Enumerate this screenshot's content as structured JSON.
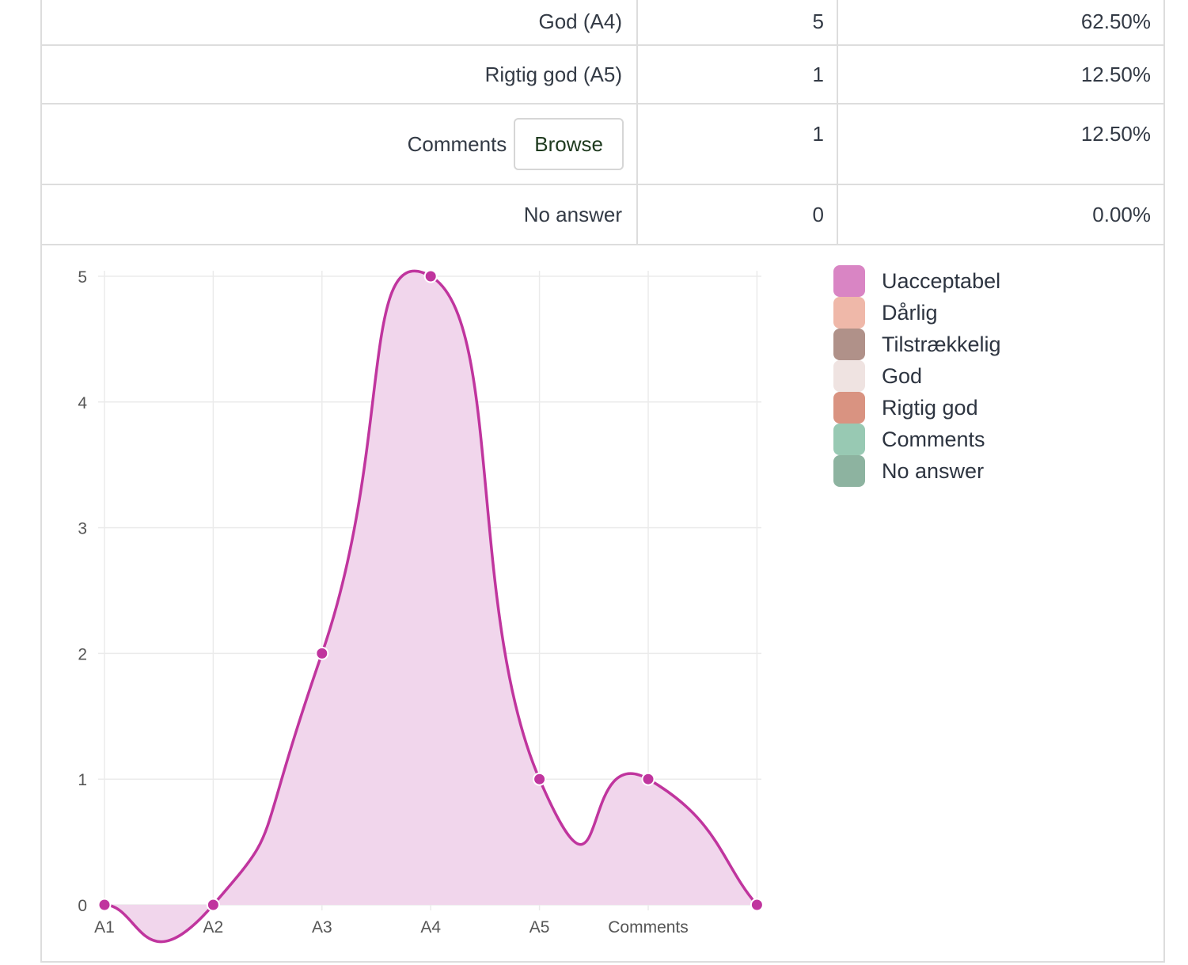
{
  "table": {
    "rows": [
      {
        "label": "God (A4)",
        "count": "5",
        "percent": "62.50%"
      },
      {
        "label": "Rigtig god (A5)",
        "count": "1",
        "percent": "12.50%"
      },
      {
        "label": "Comments",
        "button": "Browse",
        "count": "1",
        "percent": "12.50%"
      },
      {
        "label": "No answer",
        "count": "0",
        "percent": "0.00%"
      }
    ]
  },
  "chart_data": {
    "type": "area",
    "categories": [
      "A1",
      "A2",
      "A3",
      "A4",
      "A5",
      "Comments",
      ""
    ],
    "values": [
      0,
      0,
      2,
      5,
      1,
      1,
      0
    ],
    "ylim": [
      0,
      5
    ],
    "yticks": [
      "0",
      "1",
      "2",
      "3",
      "4",
      "5"
    ],
    "grid": true,
    "line_color": "#c0359e",
    "fill_color": "#f1d6ec",
    "legend_position": "right",
    "legend": [
      {
        "label": "Uacceptabel",
        "color": "#d985c4"
      },
      {
        "label": "Dårlig",
        "color": "#efb8a9"
      },
      {
        "label": "Tilstrækkelig",
        "color": "#b09189"
      },
      {
        "label": "God",
        "color": "#efe3e1"
      },
      {
        "label": "Rigtig god",
        "color": "#d99381"
      },
      {
        "label": "Comments",
        "color": "#98c9b3"
      },
      {
        "label": "No answer",
        "color": "#8db3a0"
      }
    ]
  }
}
